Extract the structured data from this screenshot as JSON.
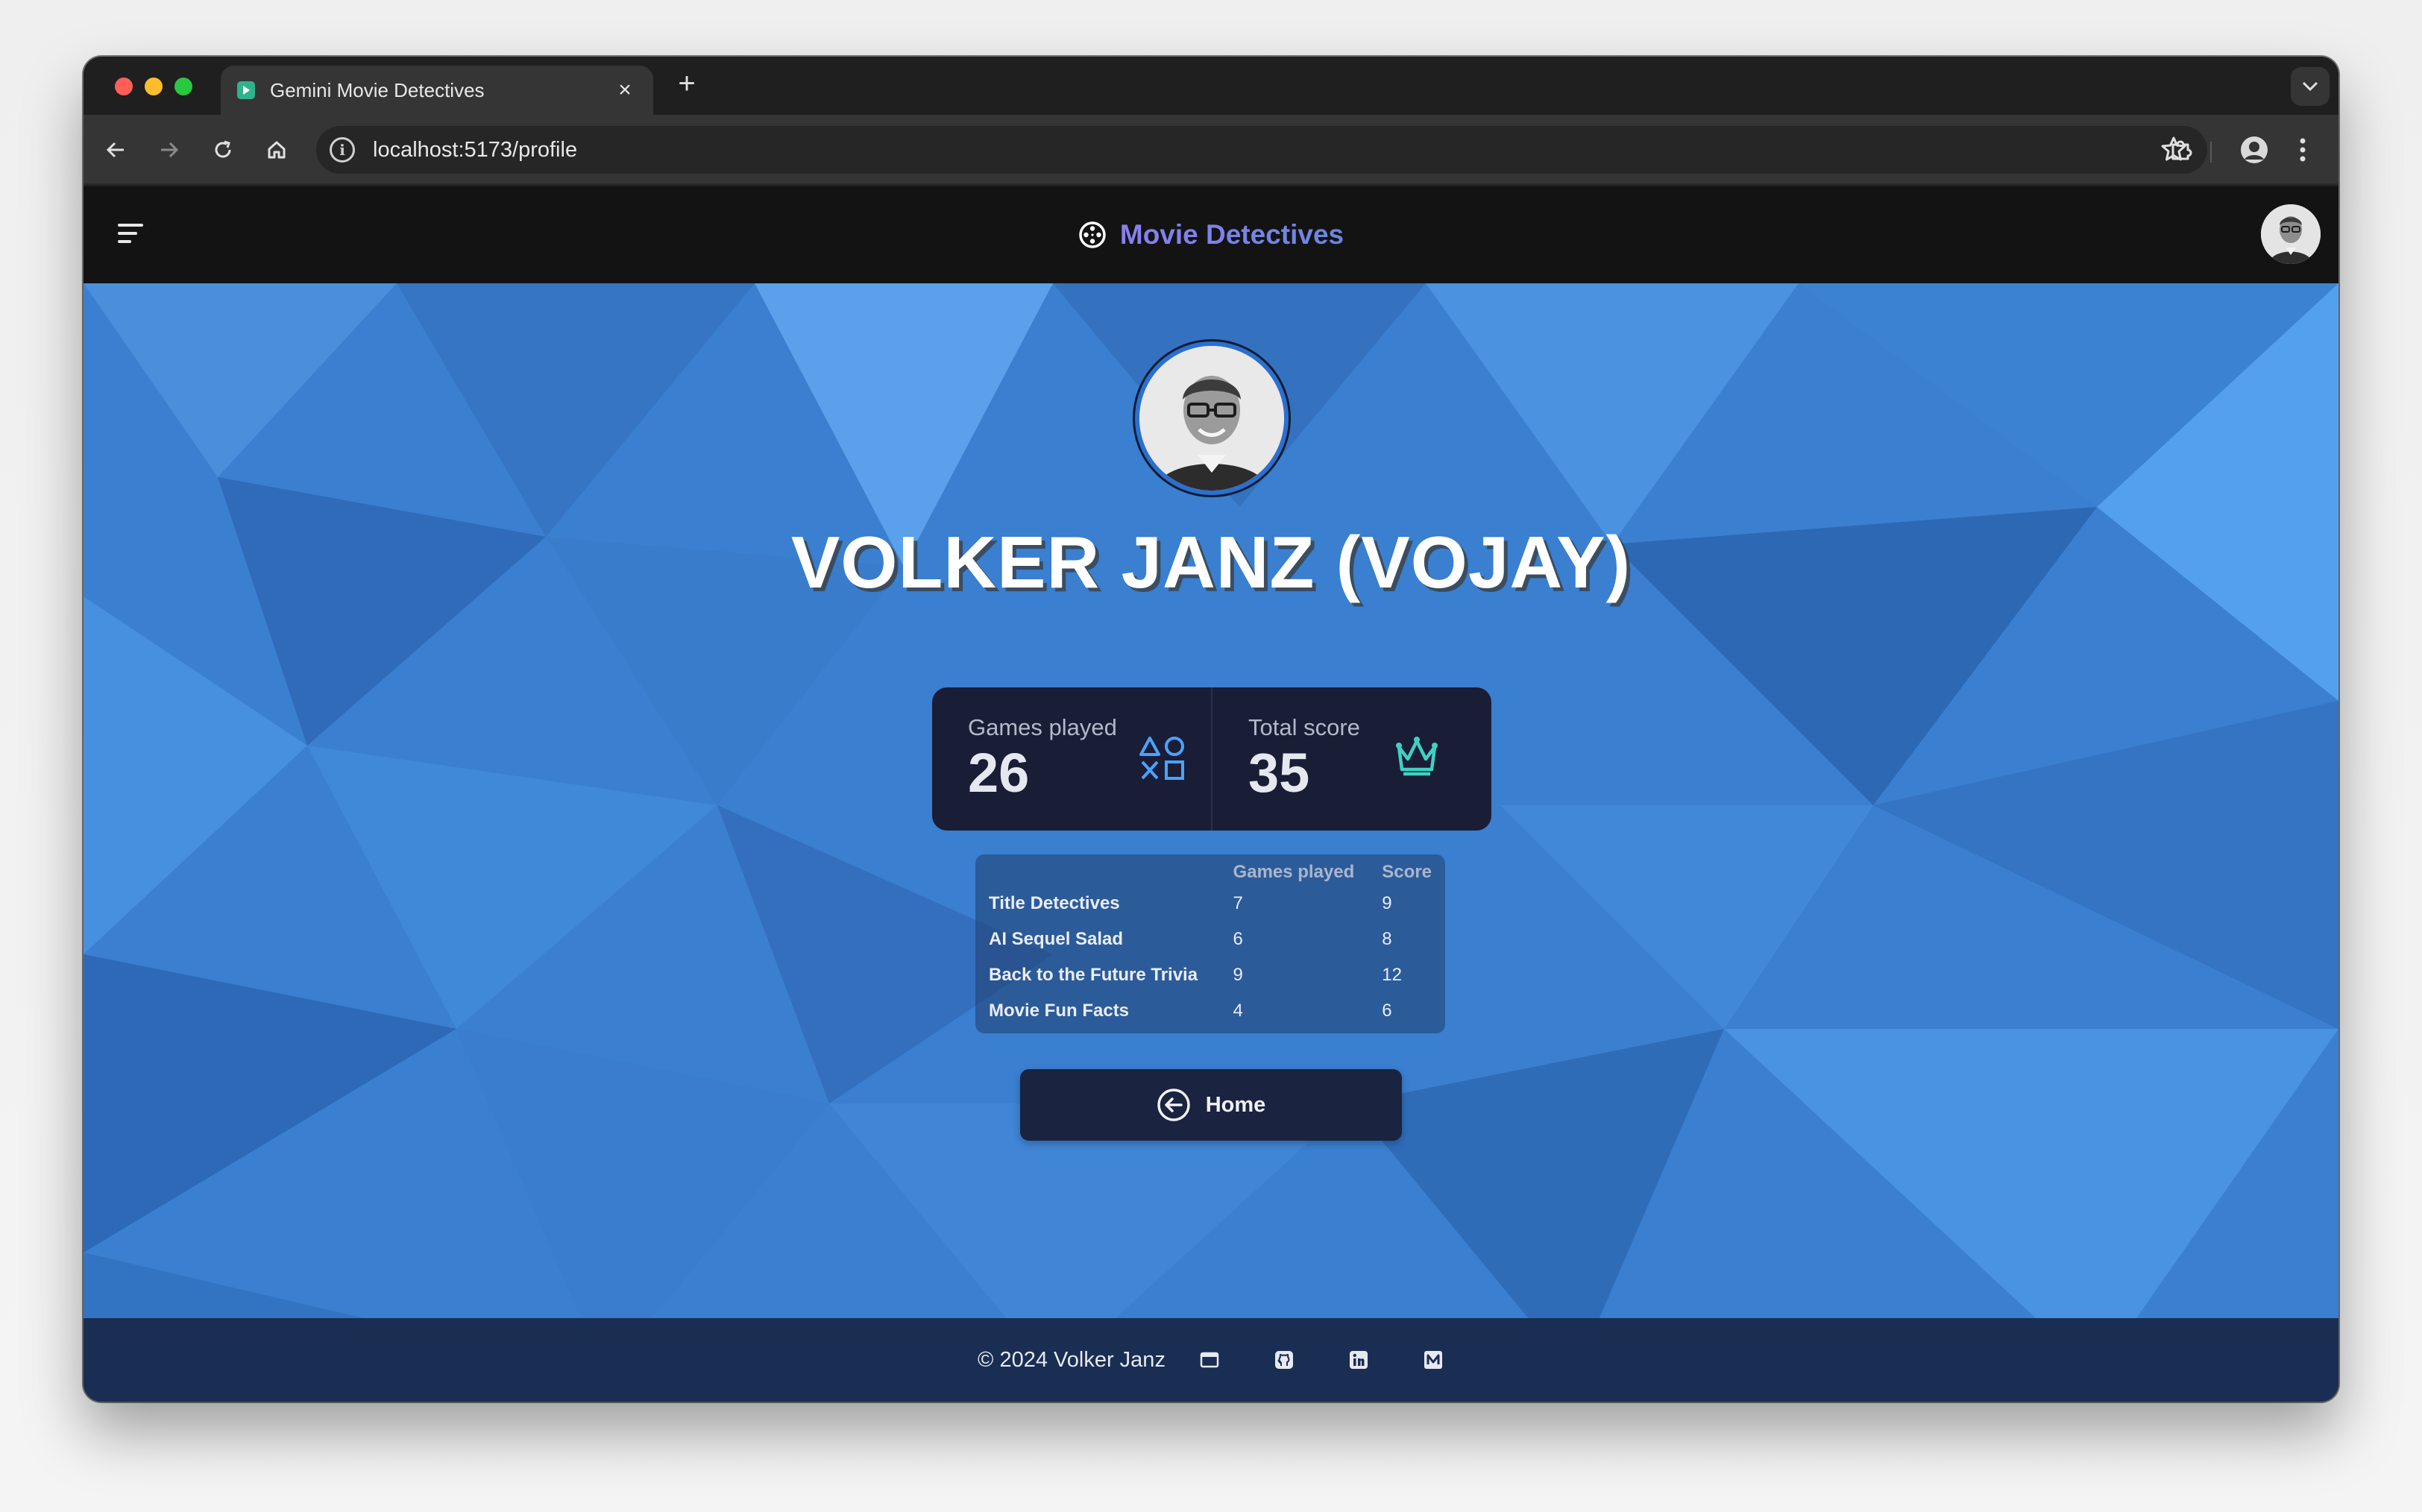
{
  "browser": {
    "tab_title": "Gemini Movie Detectives",
    "tab_close": "×",
    "new_tab": "+",
    "url": "localhost:5173/profile",
    "info_glyph": "i"
  },
  "app": {
    "brand": "Movie Detectives",
    "brand_icon": "film-reel-icon",
    "accent": "#7f7ff0"
  },
  "profile": {
    "name": "VOLKER JANZ (VOJAY)",
    "stats": {
      "games_played_label": "Games played",
      "games_played_value": "26",
      "total_score_label": "Total score",
      "total_score_value": "35"
    },
    "table": {
      "headers": [
        "",
        "Games played",
        "Score"
      ],
      "rows": [
        {
          "game": "Title Detectives",
          "played": "7",
          "score": "9"
        },
        {
          "game": "AI Sequel Salad",
          "played": "6",
          "score": "8"
        },
        {
          "game": "Back to the Future Trivia",
          "played": "9",
          "score": "12"
        },
        {
          "game": "Movie Fun Facts",
          "played": "4",
          "score": "6"
        }
      ]
    },
    "home_button": "Home"
  },
  "footer": {
    "copyright": "© 2024 Volker Janz",
    "links": [
      "browser-window-icon",
      "github-icon",
      "linkedin-icon",
      "medium-icon"
    ]
  },
  "colors": {
    "background_blue": "#3a7fd0",
    "stats_panel": "#1a1d36",
    "icon_blue": "#4aa3ff",
    "icon_teal": "#3fd1c0",
    "footer": "#1a2d52"
  }
}
